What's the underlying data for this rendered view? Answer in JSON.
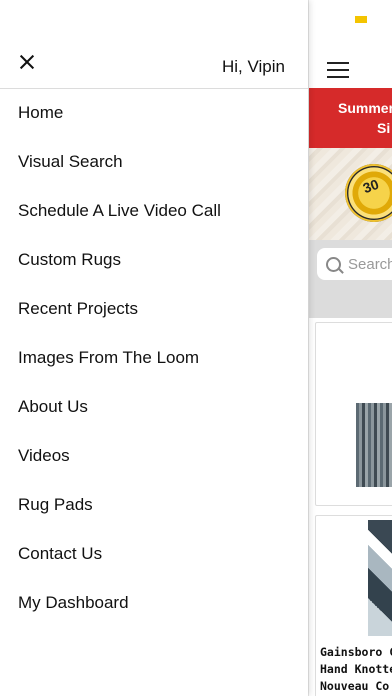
{
  "drawer": {
    "greeting": "Hi, Vipin",
    "menu_items": [
      {
        "label": "Home"
      },
      {
        "label": "Visual Search"
      },
      {
        "label": "Schedule A Live Video Call"
      },
      {
        "label": "Custom Rugs"
      },
      {
        "label": "Recent Projects"
      },
      {
        "label": "Images From The Loom"
      },
      {
        "label": "About Us"
      },
      {
        "label": "Videos"
      },
      {
        "label": "Rug Pads"
      },
      {
        "label": "Contact Us"
      },
      {
        "label": "My Dashboard"
      }
    ]
  },
  "background_app": {
    "promo_line1": "Summer",
    "promo_line2": "Si",
    "badge_text": "30",
    "search_placeholder": "Search",
    "product_title": "Gainsboro C\nHand Knotte\nNouveau Co"
  },
  "colors": {
    "promo_red": "#d62a2a",
    "status_yellow": "#f4c400"
  }
}
